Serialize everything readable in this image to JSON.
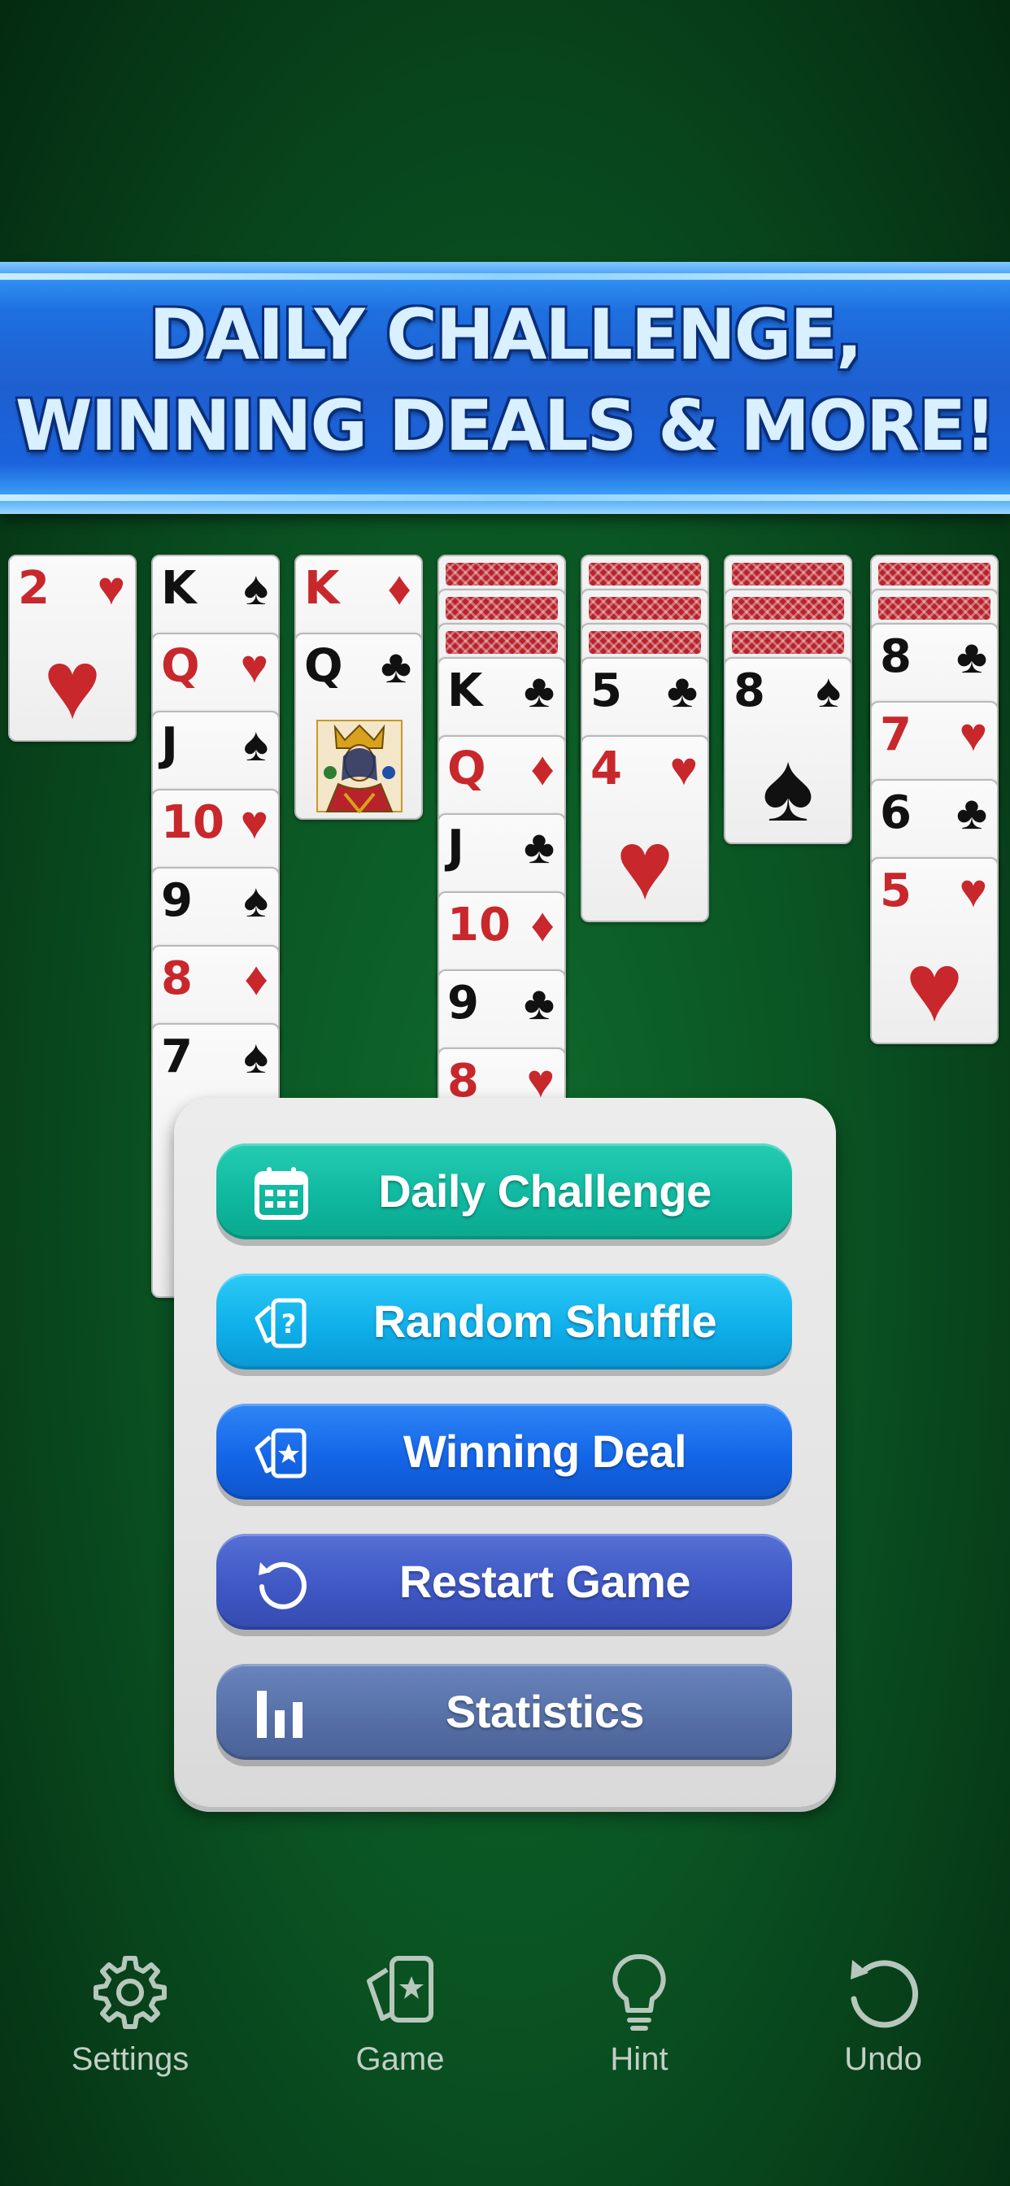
{
  "banner": {
    "line1": "DAILY CHALLENGE,",
    "line2": "WINNING DEALS  &  MORE!"
  },
  "tableau": {
    "col1": [
      {
        "rank": "2",
        "suit": "♥"
      }
    ],
    "col2": [
      {
        "rank": "K",
        "suit": "♠"
      },
      {
        "rank": "Q",
        "suit": "♥"
      },
      {
        "rank": "J",
        "suit": "♠"
      },
      {
        "rank": "10",
        "suit": "♥"
      },
      {
        "rank": "9",
        "suit": "♠"
      },
      {
        "rank": "8",
        "suit": "♦"
      },
      {
        "rank": "7",
        "suit": "♠"
      }
    ],
    "col3": [
      {
        "rank": "K",
        "suit": "♦"
      },
      {
        "rank": "Q",
        "suit": "♣"
      }
    ],
    "col4": [
      {
        "rank": "K",
        "suit": "♣"
      },
      {
        "rank": "Q",
        "suit": "♦"
      },
      {
        "rank": "J",
        "suit": "♣"
      },
      {
        "rank": "10",
        "suit": "♦"
      },
      {
        "rank": "9",
        "suit": "♣"
      },
      {
        "rank": "8",
        "suit": "♥"
      }
    ],
    "col5": [
      {
        "rank": "5",
        "suit": "♣"
      },
      {
        "rank": "4",
        "suit": "♥"
      }
    ],
    "col6": [
      {
        "rank": "8",
        "suit": "♠"
      }
    ],
    "col7": [
      {
        "rank": "8",
        "suit": "♣"
      },
      {
        "rank": "7",
        "suit": "♥"
      },
      {
        "rank": "6",
        "suit": "♣"
      },
      {
        "rank": "5",
        "suit": "♥"
      }
    ]
  },
  "menu": {
    "daily_challenge": "Daily Challenge",
    "random_shuffle": "Random Shuffle",
    "winning_deal": "Winning Deal",
    "restart_game": "Restart Game",
    "statistics": "Statistics"
  },
  "colors": {
    "daily_challenge": "#0fb89f",
    "random_shuffle": "#0fb0ea",
    "winning_deal": "#1466e8",
    "restart_game": "#3f58c4",
    "statistics": "#5670a8",
    "felt": "#0a5423",
    "card_red": "#c8272c"
  },
  "nav": {
    "settings": "Settings",
    "game": "Game",
    "hint": "Hint",
    "undo": "Undo"
  },
  "icons": {
    "daily_challenge": "calendar-icon",
    "random_shuffle": "shuffle-cards-icon",
    "winning_deal": "star-cards-icon",
    "restart_game": "restart-icon",
    "statistics": "bar-chart-icon",
    "settings": "gear-icon",
    "game": "card-star-icon",
    "hint": "lightbulb-icon",
    "undo": "undo-icon"
  }
}
